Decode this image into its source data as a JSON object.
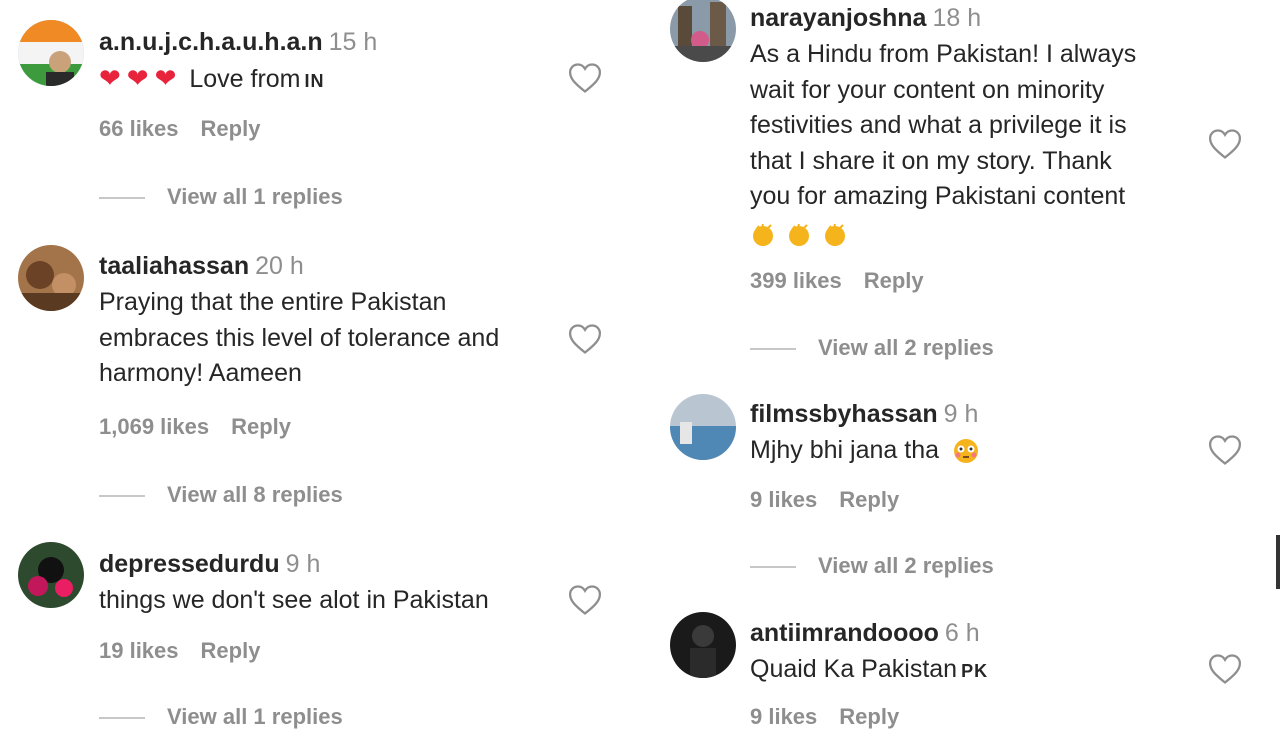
{
  "left": {
    "comments": [
      {
        "username": "a.n.u.j.c.h.a.u.h.a.n",
        "time": "15 h",
        "text": "Love from",
        "flag": "IN",
        "likes": "66 likes",
        "reply": "Reply",
        "view_replies": "View all 1 replies"
      },
      {
        "username": "taaliahassan",
        "time": "20 h",
        "text_lines": [
          "Praying that the entire Pakistan",
          "embraces this level of tolerance and",
          "harmony! Aameen"
        ],
        "likes": "1,069 likes",
        "reply": "Reply",
        "view_replies": "View all 8 replies"
      },
      {
        "username": "depressedurdu",
        "time": "9 h",
        "text": "things we don't see alot in Pakistan",
        "likes": "19 likes",
        "reply": "Reply",
        "view_replies": "View all 1 replies"
      }
    ]
  },
  "right": {
    "comments": [
      {
        "username": "narayanjoshna",
        "time": "18 h",
        "text_lines": [
          "As a Hindu from Pakistan! I always",
          "wait for your content on minority",
          "festivities and what a privilege it is",
          "that I share it on my story. Thank",
          "you for amazing Pakistani content"
        ],
        "likes": "399 likes",
        "reply": "Reply",
        "view_replies": "View all 2 replies"
      },
      {
        "username": "filmssbyhassan",
        "time": "9 h",
        "text": "Mjhy bhi jana tha",
        "likes": "9 likes",
        "reply": "Reply",
        "view_replies": "View all 2 replies"
      },
      {
        "username": "antiimrandoooo",
        "time": "6 h",
        "text": "Quaid Ka Pakistan",
        "flag": "PK",
        "likes": "9 likes",
        "reply": "Reply"
      }
    ]
  },
  "icons": {
    "like": "heart-outline-icon",
    "emoji_heart": "red-heart-emoji",
    "emoji_clap": "clapping-hands-emoji",
    "emoji_flushed": "flushed-face-emoji"
  },
  "colors": {
    "text": "#262626",
    "muted": "#8e8e8e",
    "heart_emoji": "#e8243c"
  }
}
